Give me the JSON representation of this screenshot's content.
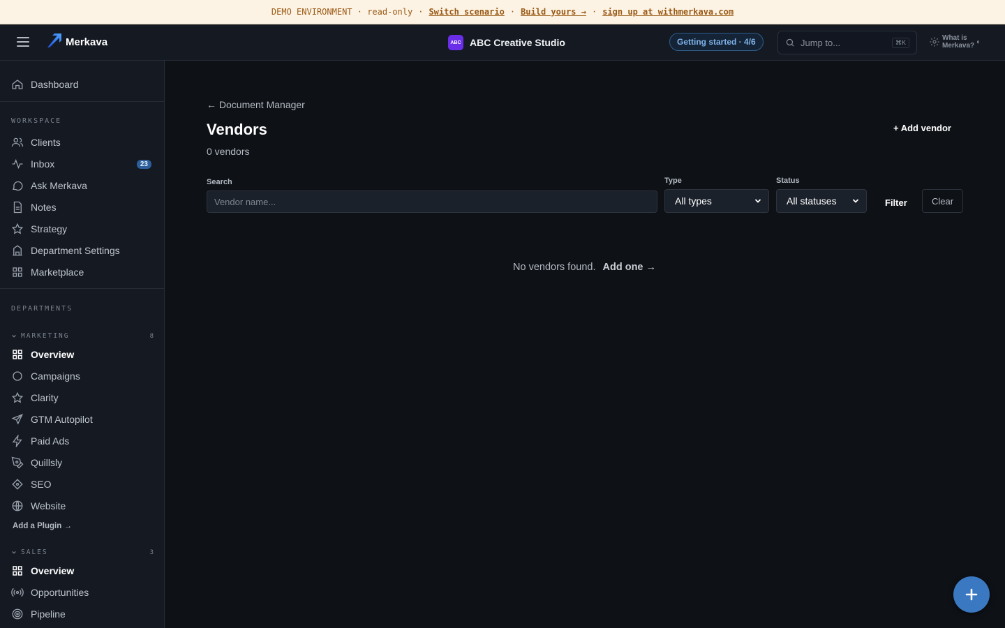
{
  "demo_banner": {
    "prefix": "DEMO ENVIRONMENT · read-only",
    "switch_scenario": "Switch scenario",
    "build_yours": "Build yours →",
    "signup": "sign up at withmerkava.com",
    "separator": "·"
  },
  "topbar": {
    "brand": "Merkava",
    "org_badge": "ABC",
    "org_name": "ABC Creative Studio",
    "getting_started": "Getting started · 4/6",
    "jump_placeholder": "Jump to...",
    "jump_shortcut": "⌘K",
    "what_is_line1": "What is",
    "what_is_line2": "Merkava?"
  },
  "sidebar": {
    "dashboard": "Dashboard",
    "workspace_label": "WORKSPACE",
    "workspace_items": [
      {
        "label": "Clients",
        "icon": "users-icon"
      },
      {
        "label": "Inbox",
        "icon": "activity-icon",
        "badge": "23"
      },
      {
        "label": "Ask Merkava",
        "icon": "chat-icon"
      },
      {
        "label": "Notes",
        "icon": "document-icon"
      },
      {
        "label": "Strategy",
        "icon": "star-icon"
      },
      {
        "label": "Department Settings",
        "icon": "building-icon"
      },
      {
        "label": "Marketplace",
        "icon": "grid-icon"
      }
    ],
    "departments_label": "DEPARTMENTS",
    "marketing": {
      "label": "MARKETING",
      "count": "8",
      "items": [
        {
          "label": "Overview",
          "icon": "grid-icon",
          "active": true
        },
        {
          "label": "Campaigns",
          "icon": "circle-icon"
        },
        {
          "label": "Clarity",
          "icon": "star-icon"
        },
        {
          "label": "GTM Autopilot",
          "icon": "send-icon"
        },
        {
          "label": "Paid Ads",
          "icon": "zap-icon"
        },
        {
          "label": "Quillsly",
          "icon": "pen-icon"
        },
        {
          "label": "SEO",
          "icon": "diamond-icon"
        },
        {
          "label": "Website",
          "icon": "globe-icon"
        }
      ],
      "add_plugin": "Add a Plugin →"
    },
    "sales": {
      "label": "SALES",
      "count": "3",
      "items": [
        {
          "label": "Overview",
          "icon": "grid-icon",
          "active": true
        },
        {
          "label": "Opportunities",
          "icon": "radio-icon"
        },
        {
          "label": "Pipeline",
          "icon": "target-icon"
        }
      ]
    }
  },
  "main": {
    "back_link": "← Document Manager",
    "title": "Vendors",
    "count_text": "0 vendors",
    "add_vendor": "+ Add vendor",
    "search_label": "Search",
    "search_placeholder": "Vendor name...",
    "type_label": "Type",
    "type_value": "All types",
    "status_label": "Status",
    "status_value": "All statuses",
    "filter": "Filter",
    "clear": "Clear",
    "empty_text": "No vendors found.",
    "add_one": "Add one →"
  },
  "fab": {
    "label": "+"
  },
  "colors": {
    "background": "#0e1116",
    "sidebar": "#141922",
    "accent": "#3a78c2",
    "banner": "#fdf3e4",
    "org_badge": "#6a2ee8"
  }
}
